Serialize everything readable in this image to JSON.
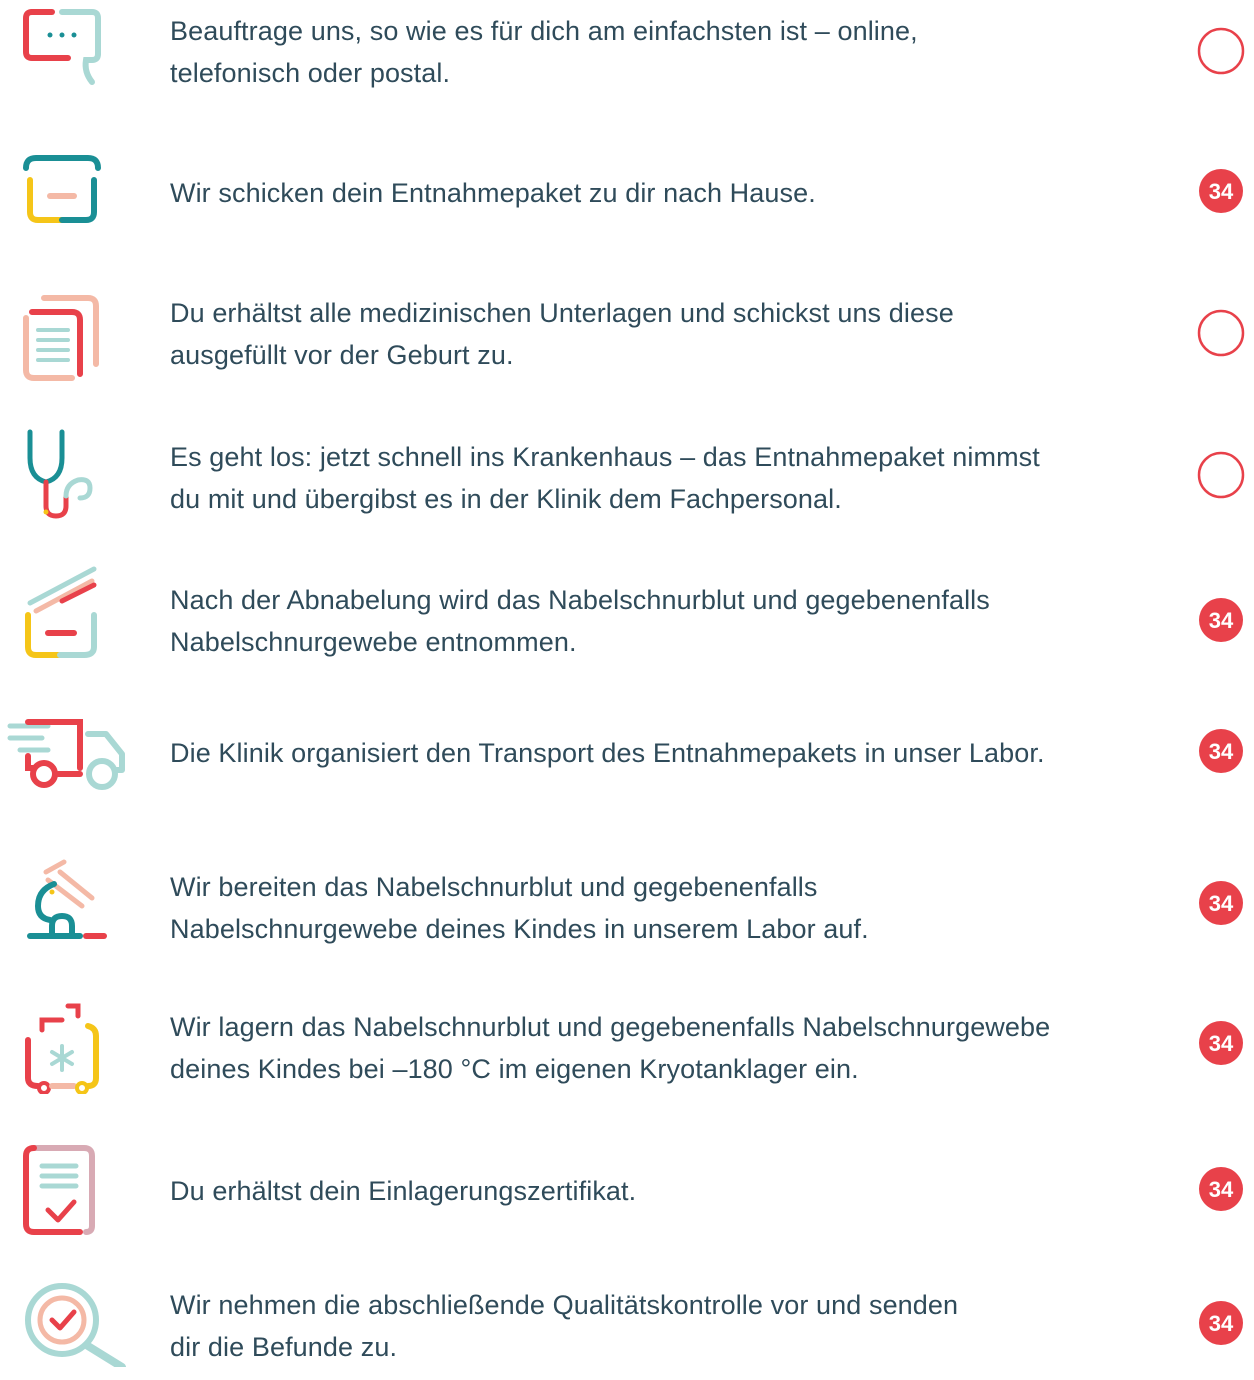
{
  "steps": [
    {
      "icon": "chat-bubble-icon",
      "text": "Beauftrage uns, so wie es für dich am einfachsten ist – online,\ntelefonisch oder postal.",
      "status": "empty"
    },
    {
      "icon": "box-icon",
      "text": "Wir schicken dein Entnahmepaket zu dir nach Hause.",
      "status": "badge",
      "badge": "34"
    },
    {
      "icon": "documents-icon",
      "text": "Du erhältst alle medizinischen Unterlagen und schickst uns diese\nausgefüllt vor der Geburt zu.",
      "status": "empty"
    },
    {
      "icon": "stethoscope-icon",
      "text": "Es geht los: jetzt schnell ins Krankenhaus – das Entnahmepaket nimmst\ndu mit und übergibst es in der Klinik dem Fachpersonal.",
      "status": "empty"
    },
    {
      "icon": "open-box-icon",
      "text": "Nach der Abnabelung wird das Nabelschnurblut und gegebenenfalls\nNabelschnurgewebe entnommen.",
      "status": "badge",
      "badge": "34"
    },
    {
      "icon": "truck-icon",
      "text": "Die Klinik organisiert den Transport des Entnahmepakets in unser Labor.",
      "status": "badge",
      "badge": "34"
    },
    {
      "icon": "microscope-icon",
      "text": "Wir bereiten das Nabelschnurblut und gegebenenfalls\nNabelschnurgewebe deines Kindes in unserem Labor auf.",
      "status": "badge",
      "badge": "34"
    },
    {
      "icon": "cryo-tank-icon",
      "text": "Wir lagern das Nabelschnurblut und gegebenenfalls Nabelschnurgewebe\ndeines Kindes bei –180 °C im eigenen Kryotanklager ein.",
      "status": "badge",
      "badge": "34"
    },
    {
      "icon": "certificate-icon",
      "text": "Du erhältst dein Einlagerungszertifikat.",
      "status": "badge",
      "badge": "34"
    },
    {
      "icon": "quality-check-icon",
      "text": "Wir nehmen die abschließende Qualitätskontrolle vor und senden\ndir die Befunde zu.",
      "status": "badge",
      "badge": "34"
    }
  ]
}
